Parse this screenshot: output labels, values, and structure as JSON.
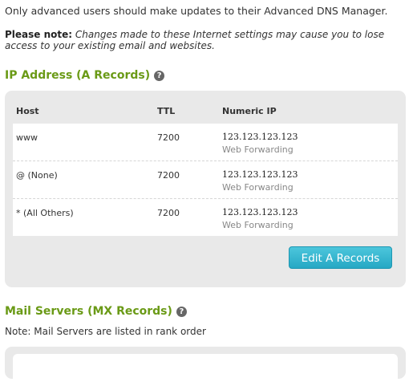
{
  "intro": "Only advanced users should make updates to their Advanced DNS Manager.",
  "note": {
    "label": "Please note:",
    "text": "Changes made to these Internet settings may cause you to lose access to your existing email and websites."
  },
  "a_records": {
    "heading": "IP Address (A Records)",
    "help_glyph": "?",
    "columns": [
      "Host",
      "TTL",
      "Numeric IP"
    ],
    "rows": [
      {
        "host": "www",
        "ttl": "7200",
        "ip": "123.123.123.123",
        "sub": "Web Forwarding"
      },
      {
        "host": "@ (None)",
        "ttl": "7200",
        "ip": "123.123.123.123",
        "sub": "Web Forwarding"
      },
      {
        "host": "* (All Others)",
        "ttl": "7200",
        "ip": "123.123.123.123",
        "sub": "Web Forwarding"
      }
    ],
    "edit_button": "Edit A Records"
  },
  "mx_records": {
    "heading": "Mail Servers (MX Records)",
    "help_glyph": "?",
    "note": "Note: Mail Servers are listed in rank order"
  },
  "colors": {
    "heading_green": "#6a9a16",
    "button_blue": "#26a8c4",
    "panel_gray": "#e9e9e9"
  }
}
